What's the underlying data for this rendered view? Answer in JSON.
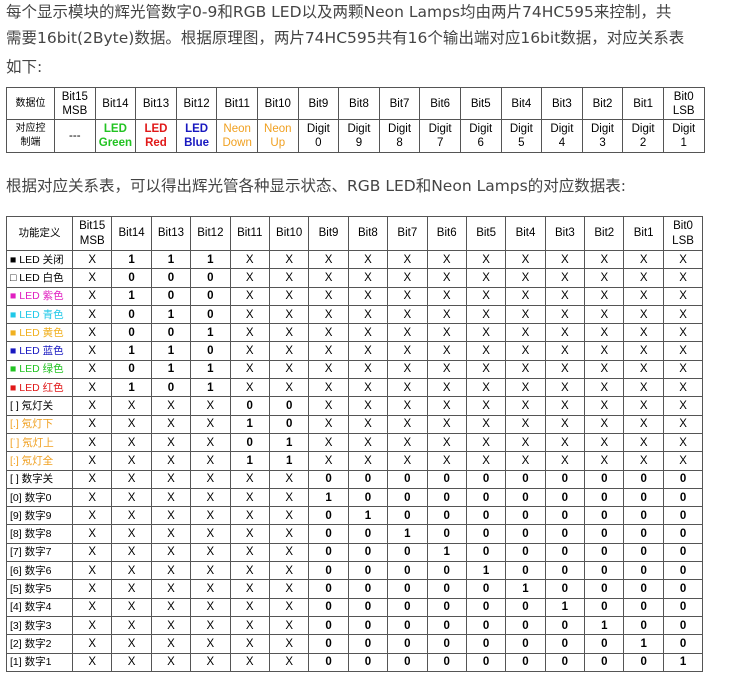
{
  "paragraphs": {
    "p1": "每个显示模块的辉光管数字0-9和RGB LED以及两颗Neon Lamps均由两片74HC595来控制，共",
    "p2": "需要16bit(2Byte)数据。根据原理图，两片74HC595共有16个输出端对应16bit数据，对应关系表",
    "p3": "如下:",
    "p4": "根据对应关系表，可以得出辉光管各种显示状态、RGB LED和Neon Lamps的对应数据表:"
  },
  "table1": {
    "row_headers": [
      "数据位",
      "对应控制端"
    ],
    "columns": [
      {
        "bit": "Bit15\nMSB",
        "ctrl": "---",
        "color": ""
      },
      {
        "bit": "Bit14",
        "ctrl": "LED\nGreen",
        "color": "#22c322"
      },
      {
        "bit": "Bit13",
        "ctrl": "LED\nRed",
        "color": "#e01818"
      },
      {
        "bit": "Bit12",
        "ctrl": "LED\nBlue",
        "color": "#1818c0"
      },
      {
        "bit": "Bit11",
        "ctrl": "Neon\nDown",
        "color": "#f0a020"
      },
      {
        "bit": "Bit10",
        "ctrl": "Neon\nUp",
        "color": "#f0a020"
      },
      {
        "bit": "Bit9",
        "ctrl": "Digit\n0",
        "color": ""
      },
      {
        "bit": "Bit8",
        "ctrl": "Digit\n9",
        "color": ""
      },
      {
        "bit": "Bit7",
        "ctrl": "Digit\n8",
        "color": ""
      },
      {
        "bit": "Bit6",
        "ctrl": "Digit\n7",
        "color": ""
      },
      {
        "bit": "Bit5",
        "ctrl": "Digit\n6",
        "color": ""
      },
      {
        "bit": "Bit4",
        "ctrl": "Digit\n5",
        "color": ""
      },
      {
        "bit": "Bit3",
        "ctrl": "Digit\n4",
        "color": ""
      },
      {
        "bit": "Bit2",
        "ctrl": "Digit\n3",
        "color": ""
      },
      {
        "bit": "Bit1",
        "ctrl": "Digit\n2",
        "color": ""
      },
      {
        "bit": "Bit0\nLSB",
        "ctrl": "Digit\n1",
        "color": ""
      }
    ]
  },
  "table2": {
    "header_label": "功能定义",
    "bit_headers": [
      "Bit15\nMSB",
      "Bit14",
      "Bit13",
      "Bit12",
      "Bit11",
      "Bit10",
      "Bit9",
      "Bit8",
      "Bit7",
      "Bit6",
      "Bit5",
      "Bit4",
      "Bit3",
      "Bit2",
      "Bit1",
      "Bit0\nLSB"
    ],
    "rows": [
      {
        "label": "■ LED 关闭",
        "color": "#000000",
        "cells": [
          "X",
          "1",
          "1",
          "1",
          "X",
          "X",
          "X",
          "X",
          "X",
          "X",
          "X",
          "X",
          "X",
          "X",
          "X",
          "X"
        ]
      },
      {
        "label": "□ LED 白色",
        "color": "#000000",
        "cells": [
          "X",
          "0",
          "0",
          "0",
          "X",
          "X",
          "X",
          "X",
          "X",
          "X",
          "X",
          "X",
          "X",
          "X",
          "X",
          "X"
        ]
      },
      {
        "label": "■ LED 紫色",
        "color": "#e020c0",
        "cells": [
          "X",
          "1",
          "0",
          "0",
          "X",
          "X",
          "X",
          "X",
          "X",
          "X",
          "X",
          "X",
          "X",
          "X",
          "X",
          "X"
        ]
      },
      {
        "label": "■ LED 青色",
        "color": "#20c8e8",
        "cells": [
          "X",
          "0",
          "1",
          "0",
          "X",
          "X",
          "X",
          "X",
          "X",
          "X",
          "X",
          "X",
          "X",
          "X",
          "X",
          "X"
        ]
      },
      {
        "label": "■ LED 黄色",
        "color": "#f0b020",
        "cells": [
          "X",
          "0",
          "0",
          "1",
          "X",
          "X",
          "X",
          "X",
          "X",
          "X",
          "X",
          "X",
          "X",
          "X",
          "X",
          "X"
        ]
      },
      {
        "label": "■ LED 蓝色",
        "color": "#1818c0",
        "cells": [
          "X",
          "1",
          "1",
          "0",
          "X",
          "X",
          "X",
          "X",
          "X",
          "X",
          "X",
          "X",
          "X",
          "X",
          "X",
          "X"
        ]
      },
      {
        "label": "■ LED 绿色",
        "color": "#22c322",
        "cells": [
          "X",
          "0",
          "1",
          "1",
          "X",
          "X",
          "X",
          "X",
          "X",
          "X",
          "X",
          "X",
          "X",
          "X",
          "X",
          "X"
        ]
      },
      {
        "label": "■ LED 红色",
        "color": "#e01818",
        "cells": [
          "X",
          "1",
          "0",
          "1",
          "X",
          "X",
          "X",
          "X",
          "X",
          "X",
          "X",
          "X",
          "X",
          "X",
          "X",
          "X"
        ]
      },
      {
        "label": "[ ] 氖灯关",
        "color": "#000000",
        "cells": [
          "X",
          "X",
          "X",
          "X",
          "0",
          "0",
          "X",
          "X",
          "X",
          "X",
          "X",
          "X",
          "X",
          "X",
          "X",
          "X"
        ]
      },
      {
        "label": "[.] 氖灯下",
        "color": "#f0a020",
        "cells": [
          "X",
          "X",
          "X",
          "X",
          "1",
          "0",
          "X",
          "X",
          "X",
          "X",
          "X",
          "X",
          "X",
          "X",
          "X",
          "X"
        ]
      },
      {
        "label": "[˙] 氖灯上",
        "color": "#f0a020",
        "cells": [
          "X",
          "X",
          "X",
          "X",
          "0",
          "1",
          "X",
          "X",
          "X",
          "X",
          "X",
          "X",
          "X",
          "X",
          "X",
          "X"
        ]
      },
      {
        "label": "[:] 氖灯全",
        "color": "#f0a020",
        "cells": [
          "X",
          "X",
          "X",
          "X",
          "1",
          "1",
          "X",
          "X",
          "X",
          "X",
          "X",
          "X",
          "X",
          "X",
          "X",
          "X"
        ]
      },
      {
        "label": "[ ] 数字关",
        "color": "#000000",
        "cells": [
          "X",
          "X",
          "X",
          "X",
          "X",
          "X",
          "0",
          "0",
          "0",
          "0",
          "0",
          "0",
          "0",
          "0",
          "0",
          "0"
        ]
      },
      {
        "label": "[0] 数字0",
        "color": "#000000",
        "cells": [
          "X",
          "X",
          "X",
          "X",
          "X",
          "X",
          "1",
          "0",
          "0",
          "0",
          "0",
          "0",
          "0",
          "0",
          "0",
          "0"
        ]
      },
      {
        "label": "[9] 数字9",
        "color": "#000000",
        "cells": [
          "X",
          "X",
          "X",
          "X",
          "X",
          "X",
          "0",
          "1",
          "0",
          "0",
          "0",
          "0",
          "0",
          "0",
          "0",
          "0"
        ]
      },
      {
        "label": "[8] 数字8",
        "color": "#000000",
        "cells": [
          "X",
          "X",
          "X",
          "X",
          "X",
          "X",
          "0",
          "0",
          "1",
          "0",
          "0",
          "0",
          "0",
          "0",
          "0",
          "0"
        ]
      },
      {
        "label": "[7] 数字7",
        "color": "#000000",
        "cells": [
          "X",
          "X",
          "X",
          "X",
          "X",
          "X",
          "0",
          "0",
          "0",
          "1",
          "0",
          "0",
          "0",
          "0",
          "0",
          "0"
        ]
      },
      {
        "label": "[6] 数字6",
        "color": "#000000",
        "cells": [
          "X",
          "X",
          "X",
          "X",
          "X",
          "X",
          "0",
          "0",
          "0",
          "0",
          "1",
          "0",
          "0",
          "0",
          "0",
          "0"
        ]
      },
      {
        "label": "[5] 数字5",
        "color": "#000000",
        "cells": [
          "X",
          "X",
          "X",
          "X",
          "X",
          "X",
          "0",
          "0",
          "0",
          "0",
          "0",
          "1",
          "0",
          "0",
          "0",
          "0"
        ]
      },
      {
        "label": "[4] 数字4",
        "color": "#000000",
        "cells": [
          "X",
          "X",
          "X",
          "X",
          "X",
          "X",
          "0",
          "0",
          "0",
          "0",
          "0",
          "0",
          "1",
          "0",
          "0",
          "0"
        ]
      },
      {
        "label": "[3] 数字3",
        "color": "#000000",
        "cells": [
          "X",
          "X",
          "X",
          "X",
          "X",
          "X",
          "0",
          "0",
          "0",
          "0",
          "0",
          "0",
          "0",
          "1",
          "0",
          "0"
        ]
      },
      {
        "label": "[2] 数字2",
        "color": "#000000",
        "cells": [
          "X",
          "X",
          "X",
          "X",
          "X",
          "X",
          "0",
          "0",
          "0",
          "0",
          "0",
          "0",
          "0",
          "0",
          "1",
          "0"
        ]
      },
      {
        "label": "[1] 数字1",
        "color": "#000000",
        "cells": [
          "X",
          "X",
          "X",
          "X",
          "X",
          "X",
          "0",
          "0",
          "0",
          "0",
          "0",
          "0",
          "0",
          "0",
          "0",
          "1"
        ]
      }
    ]
  }
}
